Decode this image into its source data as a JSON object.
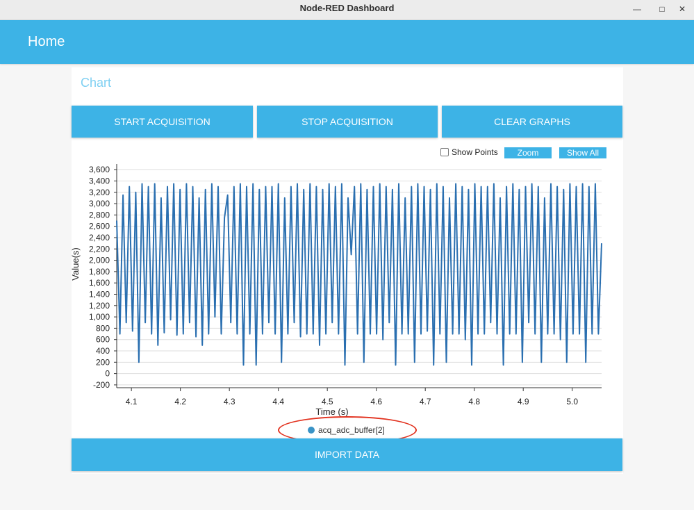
{
  "window": {
    "title": "Node-RED Dashboard",
    "controls": [
      "minimize-icon",
      "maximize-icon",
      "close-icon"
    ]
  },
  "header": {
    "title": "Home"
  },
  "group": {
    "title": "Chart"
  },
  "buttons": {
    "start": "START ACQUISITION",
    "stop": "STOP ACQUISITION",
    "clear": "CLEAR GRAPHS",
    "import": "IMPORT DATA"
  },
  "chart_controls": {
    "show_points": "Show Points",
    "zoom": "Zoom",
    "show_all": "Show All"
  },
  "colors": {
    "accent": "#3db3e6",
    "series": "#2a6fb0",
    "annotation": "#e2321f"
  },
  "chart_data": {
    "type": "line",
    "xlabel": "Time (s)",
    "ylabel": "Value(s)",
    "xlim": [
      4.07,
      5.06
    ],
    "ylim": [
      -250,
      3700
    ],
    "x_ticks": [
      "4.1",
      "4.2",
      "4.3",
      "4.4",
      "4.5",
      "4.6",
      "4.7",
      "4.8",
      "4.9",
      "5.0"
    ],
    "y_ticks": [
      "3,600",
      "3,400",
      "3,200",
      "3,000",
      "2,800",
      "2,600",
      "2,400",
      "2,200",
      "2,000",
      "1,800",
      "1,600",
      "1,400",
      "1,200",
      "1,000",
      "800",
      "600",
      "400",
      "200",
      "0",
      "-200"
    ],
    "grid": true,
    "legend_position": "bottom",
    "series": [
      {
        "name": "acq_adc_buffer[2]",
        "x_start": 4.07,
        "x_end": 5.06,
        "values": [
          2700,
          700,
          3150,
          900,
          3300,
          750,
          3200,
          200,
          3350,
          900,
          3300,
          700,
          3350,
          500,
          3100,
          720,
          3300,
          950,
          3350,
          680,
          3250,
          700,
          3350,
          900,
          3300,
          650,
          3100,
          500,
          3250,
          700,
          3350,
          1000,
          3300,
          700,
          2750,
          3150,
          900,
          3300,
          700,
          3350,
          150,
          3300,
          700,
          3350,
          150,
          3250,
          700,
          3300,
          900,
          3300,
          700,
          3350,
          200,
          3100,
          700,
          3300,
          900,
          3350,
          650,
          3250,
          700,
          3350,
          700,
          3300,
          500,
          3250,
          700,
          3350,
          900,
          3300,
          700,
          3350,
          150,
          3100,
          2100,
          3300,
          700,
          3350,
          200,
          3250,
          700,
          3300,
          700,
          3350,
          600,
          3300,
          900,
          3250,
          150,
          3350,
          700,
          3100,
          700,
          3300,
          200,
          3350,
          700,
          3300,
          750,
          3250,
          150,
          3350,
          700,
          3300,
          200,
          3100,
          700,
          3350,
          700,
          3300,
          600,
          3250,
          150,
          3350,
          700,
          3300,
          700,
          3300,
          900,
          3350,
          700,
          3100,
          150,
          3300,
          700,
          3350,
          700,
          3250,
          200,
          3300,
          900,
          3350,
          700,
          3300,
          200,
          3100,
          700,
          3350,
          700,
          3300,
          600,
          3250,
          200,
          3350,
          700,
          3300,
          700,
          3350,
          200,
          3300,
          700,
          3350,
          700,
          2300
        ]
      }
    ]
  }
}
